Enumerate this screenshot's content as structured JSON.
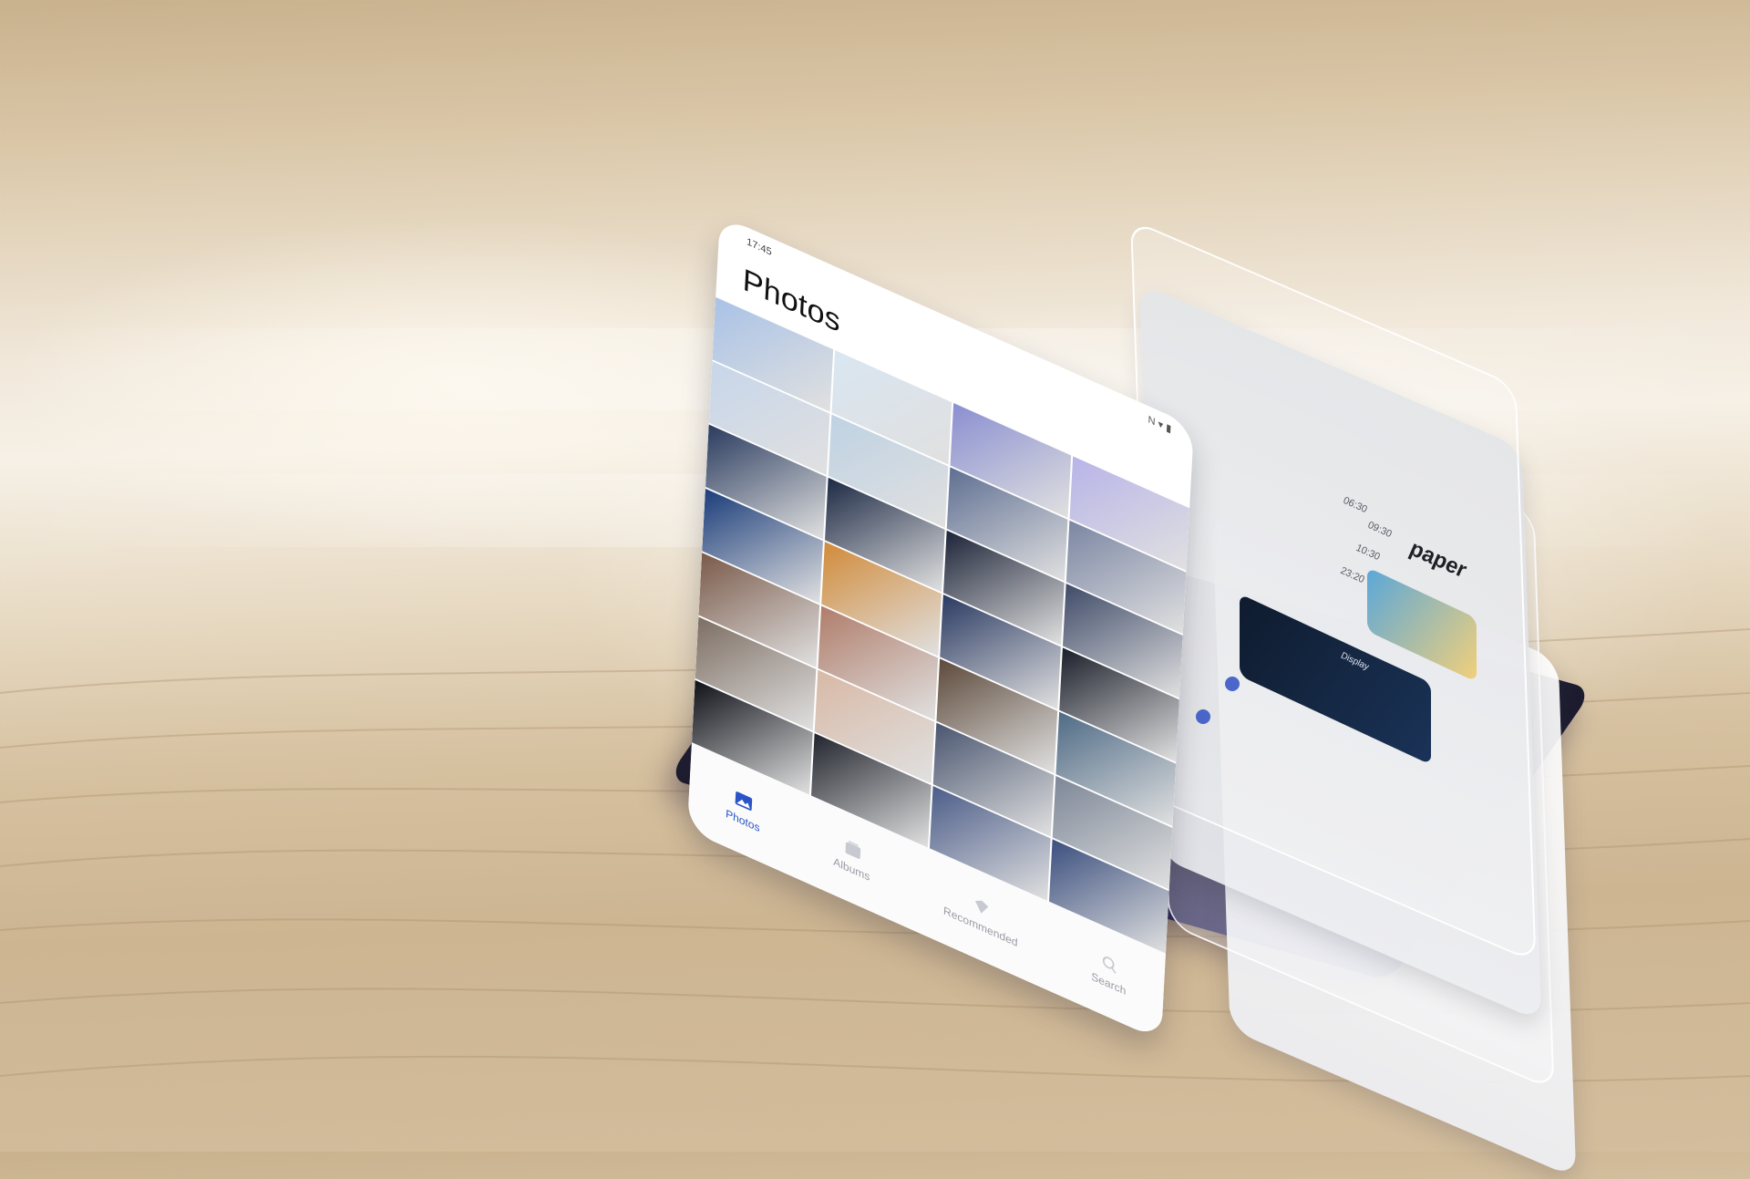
{
  "screen": {
    "status_time": "17:45",
    "status_right": "N ▾ ▮",
    "title": "Photos",
    "nav": [
      {
        "label": "Photos",
        "icon": "photos-icon",
        "active": true
      },
      {
        "label": "Albums",
        "icon": "albums-icon",
        "active": false
      },
      {
        "label": "Recommended",
        "icon": "recommended-icon",
        "active": false
      },
      {
        "label": "Search",
        "icon": "search-icon",
        "active": false
      }
    ]
  },
  "back_sheet": {
    "label": "paper",
    "times": [
      "06:30",
      "09:30",
      "10:30",
      "23:20"
    ],
    "card_label": "Display"
  },
  "colors": {
    "accent": "#2b55c7",
    "sheet_bg": "#ffffff",
    "phone_frame": "#6a6cb8"
  },
  "grid_tiles": [
    "#a9c2e6",
    "#d9e6f1",
    "#8a8fd0",
    "#b8b4e8",
    "#c7d6ea",
    "#bfd2e3",
    "#5f6f92",
    "#7b86a3",
    "#2a3b5e",
    "#1d2a45",
    "#1d2438",
    "#3f4b68",
    "#1b3d7a",
    "#d18b3a",
    "#2a3a62",
    "#1b1f2a",
    "#7a5a4a",
    "#b07d6a",
    "#5d4a3b",
    "#4f6b86",
    "#7d6e63",
    "#d8b9a6",
    "#4a5670",
    "#7d8797",
    "#0f1118",
    "#22252e",
    "#4c5d89",
    "#3b4f7e"
  ]
}
